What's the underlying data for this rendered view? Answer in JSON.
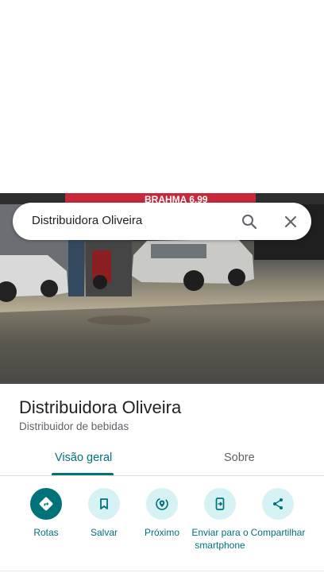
{
  "search": {
    "query": "Distribuidora Oliveira",
    "icons": [
      "search-icon",
      "close-icon"
    ]
  },
  "photo": {
    "sign_text": "BRAHMA 6,99"
  },
  "place": {
    "title": "Distribuidora Oliveira",
    "category": "Distribuidor de bebidas"
  },
  "tabs": [
    {
      "label": "Visão geral",
      "selected": true
    },
    {
      "label": "Sobre",
      "selected": false
    }
  ],
  "actions": [
    {
      "label": "Rotas",
      "icon": "directions-icon"
    },
    {
      "label": "Salvar",
      "icon": "bookmark-icon"
    },
    {
      "label": "Próximo",
      "icon": "nearby-icon"
    },
    {
      "label": "Enviar para o smartphone",
      "icon": "send-to-phone-icon"
    },
    {
      "label": "Compartilhar",
      "icon": "share-icon"
    }
  ],
  "colors": {
    "accent": "#00727a",
    "accent_light": "#d7f2f5",
    "text_primary": "#202124",
    "text_secondary": "#5f6368"
  }
}
